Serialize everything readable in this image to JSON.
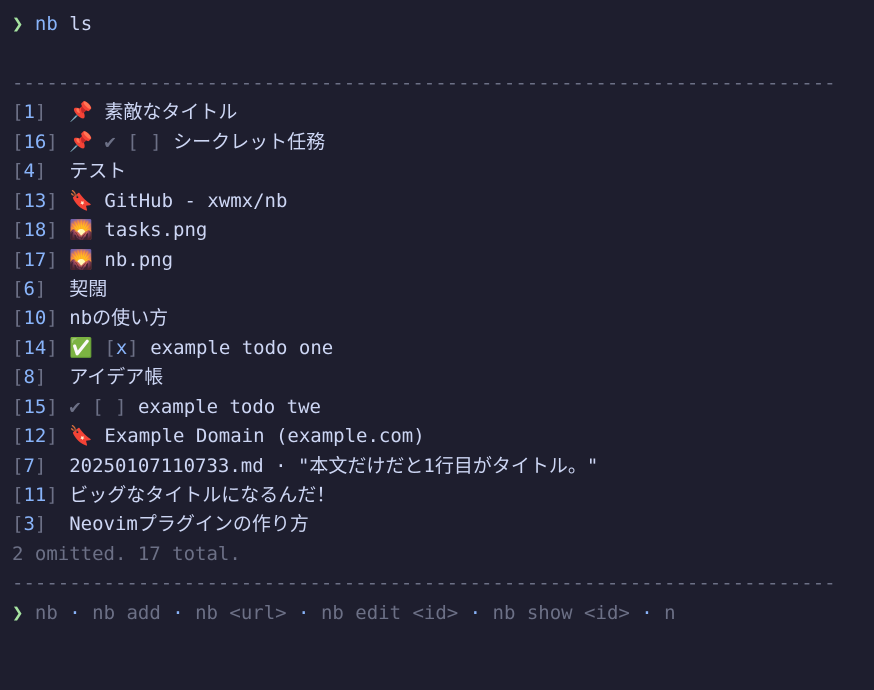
{
  "prompt": {
    "symbol": "❯",
    "program": "nb",
    "arg": "ls"
  },
  "divider": "------------------------------------------------------------------------",
  "items": [
    {
      "id": "1",
      "icon": "📌",
      "checkbox": null,
      "title": "素敵なタイトル"
    },
    {
      "id": "16",
      "icon": "📌",
      "checkbox": "dim-empty",
      "title": "シークレット任務",
      "check_prefix": "dim"
    },
    {
      "id": "4",
      "icon": null,
      "checkbox": null,
      "title": "テスト"
    },
    {
      "id": "13",
      "icon": "🔖",
      "checkbox": null,
      "title": "GitHub - xwmx/nb"
    },
    {
      "id": "18",
      "icon": "🌄",
      "checkbox": null,
      "title": "tasks.png"
    },
    {
      "id": "17",
      "icon": "🌄",
      "checkbox": null,
      "title": "nb.png"
    },
    {
      "id": "6",
      "icon": null,
      "checkbox": null,
      "title": "契闊"
    },
    {
      "id": "10",
      "icon": null,
      "checkbox": null,
      "title": "nbの使い方"
    },
    {
      "id": "14",
      "icon": "✅",
      "checkbox": "checked",
      "title": "example todo one"
    },
    {
      "id": "8",
      "icon": null,
      "checkbox": null,
      "title": "アイデア帳"
    },
    {
      "id": "15",
      "icon": null,
      "checkbox": "dim-empty",
      "title": "example todo twe",
      "check_prefix": "dim"
    },
    {
      "id": "12",
      "icon": "🔖",
      "checkbox": null,
      "title": "Example Domain (example.com)"
    },
    {
      "id": "7",
      "icon": null,
      "checkbox": null,
      "title": "20250107110733.md · \"本文だけだと1行目がタイトル。\""
    },
    {
      "id": "11",
      "icon": null,
      "checkbox": null,
      "title": "ビッグなタイトルになるんだ！"
    },
    {
      "id": "3",
      "icon": null,
      "checkbox": null,
      "title": "Neovimプラグインの作り方"
    }
  ],
  "summary": "2 omitted. 17 total.",
  "hints": {
    "symbol": "❯",
    "parts": [
      "nb",
      "nb add",
      "nb <url>",
      "nb edit <id>",
      "nb show <id>",
      "n"
    ],
    "sep": "·"
  },
  "glyphs": {
    "checkmark_dim": "✔"
  }
}
